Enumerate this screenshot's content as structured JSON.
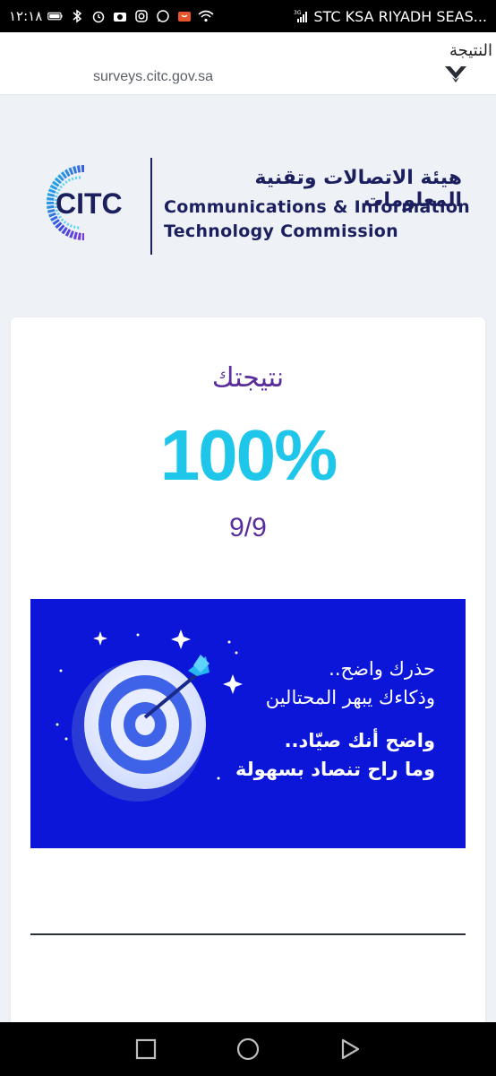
{
  "status_bar": {
    "time": "١٢:١٨",
    "carrier": "STC KSA RIYADH SEAS...",
    "network": "3G",
    "icons": [
      "battery-icon",
      "bluetooth-icon",
      "alarm-icon",
      "camera-icon",
      "instagram-icon",
      "whatsapp-icon",
      "notification-icon",
      "wifi-icon",
      "signal-icon"
    ]
  },
  "browser": {
    "url": "surveys.citc.gov.sa",
    "page_title": "النتيجة",
    "app_logo_icon": "app-logo-icon"
  },
  "brand": {
    "logo_text": "CITC",
    "name_ar": "هيئة الاتصالات وتقنية المعلومات",
    "name_en_line1": "Communications & Information",
    "name_en_line2": "Technology Commission",
    "primary_color": "#1b1f5e",
    "accent_color": "#1ec6ea"
  },
  "result": {
    "label": "نتيجتك",
    "percent": "100%",
    "fraction": "9/9",
    "label_color": "#5a2d9c"
  },
  "promo": {
    "line1": "حذرك واضح..",
    "line2": "وذكاءك يبهر المحتالين",
    "line3": "واضح أنك صيّاد..",
    "line4": "وما راح تنصاد بسهولة",
    "background_color": "#0b16d8",
    "art_icon": "dart-target-icon"
  },
  "nav": {
    "recents_icon": "square-icon",
    "home_icon": "circle-icon",
    "back_icon": "triangle-back-icon"
  }
}
